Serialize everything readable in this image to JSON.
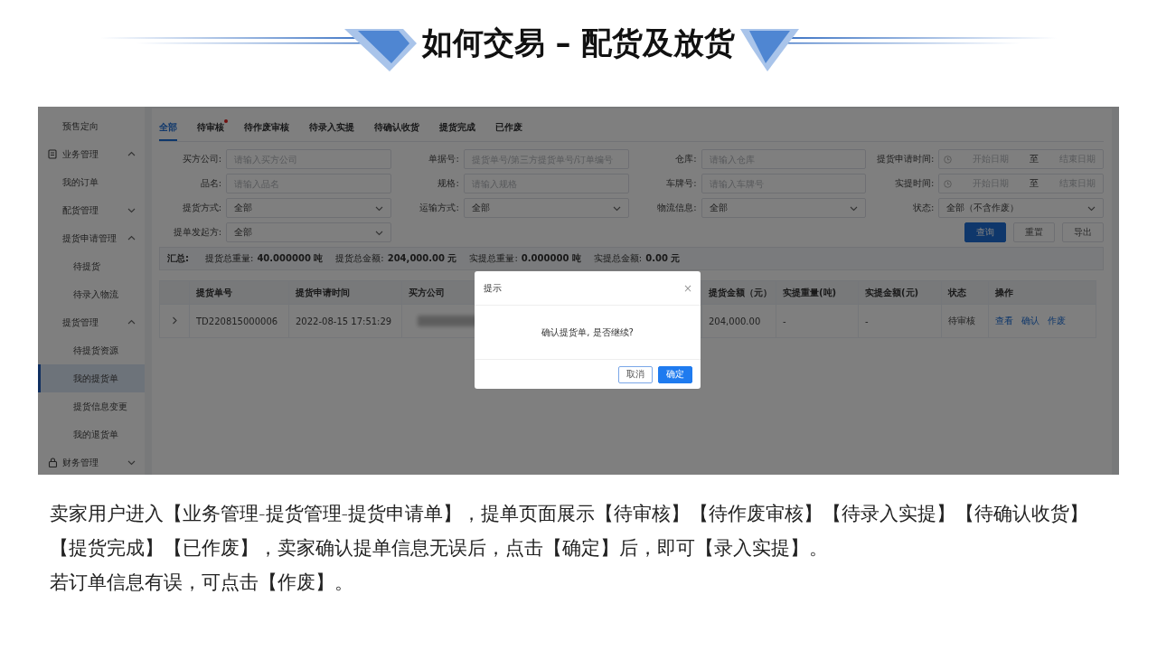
{
  "title": "如何交易 – 配货及放货",
  "screenshot": {
    "dimmed": true,
    "sidebar": {
      "items": [
        {
          "label": "预售定向",
          "selected": false
        },
        {
          "label": "业务管理",
          "expanded": true,
          "children": [
            {
              "label": "我的订单",
              "selected": false
            },
            {
              "label": "配货管理",
              "expanded": false
            },
            {
              "label": "提货申请管理",
              "expanded": true,
              "children": [
                {
                  "label": "待提货",
                  "selected": false
                },
                {
                  "label": "待录入物流",
                  "selected": false
                }
              ]
            },
            {
              "label": "提货管理",
              "expanded": true,
              "children": [
                {
                  "label": "待提货资源",
                  "selected": false
                },
                {
                  "label": "我的提货单",
                  "selected": true
                },
                {
                  "label": "提货信息变更",
                  "selected": false
                },
                {
                  "label": "我的退货单",
                  "selected": false
                }
              ]
            }
          ]
        },
        {
          "label": "财务管理",
          "expanded": false
        }
      ]
    },
    "tabs": [
      {
        "label": "全部",
        "selected": true,
        "dot": false
      },
      {
        "label": "待审核",
        "selected": false,
        "dot": true
      },
      {
        "label": "待作废审核",
        "selected": false,
        "dot": false
      },
      {
        "label": "待录入实提",
        "selected": false,
        "dot": false
      },
      {
        "label": "待确认收货",
        "selected": false,
        "dot": false
      },
      {
        "label": "提货完成",
        "selected": false,
        "dot": false
      },
      {
        "label": "已作废",
        "selected": false,
        "dot": false
      }
    ],
    "filters": [
      {
        "label": "买方公司:",
        "kind": "text",
        "placeholder": "请输入买方公司"
      },
      {
        "label": "单据号:",
        "kind": "text",
        "placeholder": "提货单号/第三方提货单号/订单编号"
      },
      {
        "label": "仓库:",
        "kind": "text",
        "placeholder": "请输入仓库"
      },
      {
        "label": "提货申请时间:",
        "kind": "daterange",
        "start_placeholder": "开始日期",
        "separator": "至",
        "end_placeholder": "结束日期"
      },
      {
        "label": "品名:",
        "kind": "text",
        "placeholder": "请输入品名"
      },
      {
        "label": "规格:",
        "kind": "text",
        "placeholder": "请输入规格"
      },
      {
        "label": "车牌号:",
        "kind": "text",
        "placeholder": "请输入车牌号"
      },
      {
        "label": "实提时间:",
        "kind": "daterange",
        "start_placeholder": "开始日期",
        "separator": "至",
        "end_placeholder": "结束日期"
      },
      {
        "label": "提货方式:",
        "kind": "select",
        "value": "全部"
      },
      {
        "label": "运输方式:",
        "kind": "select",
        "value": "全部"
      },
      {
        "label": "物流信息:",
        "kind": "select",
        "value": "全部"
      },
      {
        "label": "状态:",
        "kind": "select",
        "value": "全部（不含作废）"
      },
      {
        "label": "提单发起方:",
        "kind": "select",
        "value": "全部"
      }
    ],
    "buttons": [
      {
        "label": "查询",
        "kind": "primary"
      },
      {
        "label": "重置",
        "kind": "default"
      },
      {
        "label": "导出",
        "kind": "default"
      }
    ],
    "summary": {
      "label": "汇总:",
      "items": [
        {
          "label": "提货总重量:",
          "value": "40.000000 吨"
        },
        {
          "label": "提货总金额:",
          "value": "204,000.00 元"
        },
        {
          "label": "实提总重量:",
          "value": "0.000000 吨"
        },
        {
          "label": "实提总金额:",
          "value": "0.00 元"
        }
      ]
    },
    "table": {
      "columns": [
        "提货单号",
        "提货申请时间",
        "买方公司",
        "提货金额（元）",
        "实提重量(吨)",
        "实提金额(元)",
        "状态",
        "操作"
      ],
      "rows": [
        {
          "expandable": true,
          "cells": [
            {
              "kind": "text",
              "text": "TD220815000006"
            },
            {
              "kind": "text",
              "text": "2022-08-15 17:51:29"
            },
            {
              "kind": "blurred"
            },
            {
              "kind": "text",
              "text": "204,000.00"
            },
            {
              "kind": "text",
              "text": "-"
            },
            {
              "kind": "text",
              "text": "-"
            },
            {
              "kind": "text",
              "text": "待审核"
            }
          ],
          "actions": [
            "查看",
            "确认",
            "作废"
          ]
        }
      ]
    },
    "modal": {
      "title": "提示",
      "close": "×",
      "message": "确认提货单, 是否继续?",
      "buttons": [
        {
          "label": "取消",
          "kind": "default"
        },
        {
          "label": "确定",
          "kind": "primary"
        }
      ]
    }
  },
  "description": [
    "卖家用户进入【业务管理-提货管理-提货申请单】，提单页面展示【待审核】【待作废审核】【待录入实提】【待确认收货】【提货完成】【已作废】，卖家确认提单信息无误后，点击【确定】后，即可【录入实提】。",
    "若订单信息有误，可点击【作废】。"
  ]
}
